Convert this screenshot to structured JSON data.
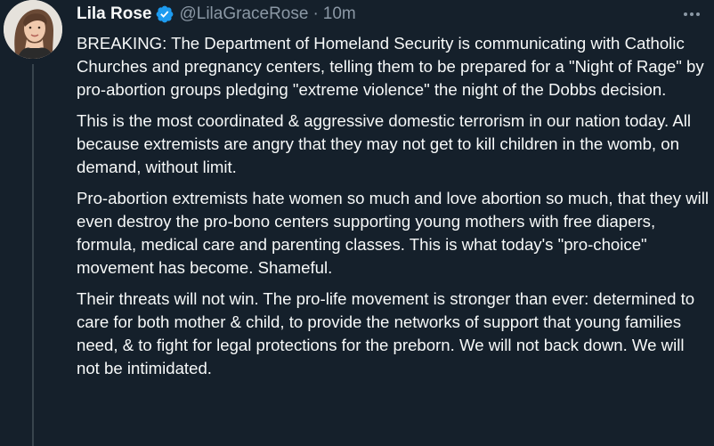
{
  "tweet": {
    "author_name": "Lila Rose",
    "handle": "@LilaGraceRose",
    "separator": "·",
    "time": "10m",
    "paragraphs": [
      "BREAKING: The Department of Homeland Security is communicating with Catholic Churches and pregnancy centers, telling them to be prepared for a \"Night of Rage\" by pro-abortion groups pledging \"extreme violence\" the night of the Dobbs decision.",
      "This is the most coordinated & aggressive domestic terrorism in our nation today. All because extremists are angry that they may not get to kill children in the womb, on demand, without limit.",
      "Pro-abortion extremists hate women so much and love abortion so much, that they will even destroy the pro-bono centers supporting young mothers with free diapers, formula, medical care and parenting classes. This is what today's \"pro-choice\" movement has become. Shameful.",
      "Their threats will not win. The pro-life movement is stronger than ever: determined to care for both mother & child, to provide the networks of support that young families need, & to fight for legal protections for the preborn. We will not back down. We will not be intimidated."
    ]
  },
  "icons": {
    "verified": "verified-badge-icon",
    "more": "more-options-icon"
  },
  "colors": {
    "background": "#15202b",
    "text": "#f7f9f9",
    "secondary_text": "#8b98a5",
    "verified_blue": "#1d9bf0",
    "thread_line": "#38444d"
  }
}
